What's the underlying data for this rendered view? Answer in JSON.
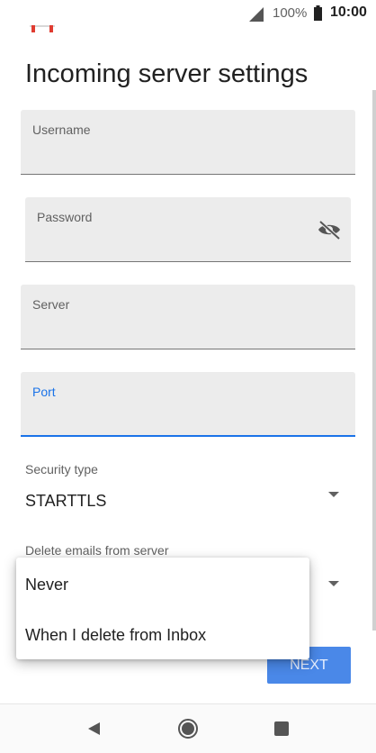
{
  "status_bar": {
    "battery_percent": "100%",
    "time": "10:00",
    "icons": [
      "gmail-icon",
      "signal-icon",
      "battery-icon"
    ]
  },
  "page": {
    "title": "Incoming server settings"
  },
  "fields": {
    "username": {
      "label": "Username",
      "value": ""
    },
    "password": {
      "label": "Password",
      "value": "",
      "toggle_icon": "visibility-off-icon"
    },
    "server": {
      "label": "Server",
      "value": ""
    },
    "port": {
      "label": "Port",
      "value": ""
    }
  },
  "security": {
    "label": "Security type",
    "value": "STARTTLS"
  },
  "delete_emails": {
    "label": "Delete emails from server"
  },
  "popup_menu": {
    "items": [
      "Never",
      "When I delete from Inbox"
    ]
  },
  "actions": {
    "next_label": "NEXT"
  },
  "colors": {
    "accent": "#1a73e8",
    "button": "#4a88e8",
    "field_background": "#ececec"
  },
  "nav_bar": {
    "icons": [
      "back-icon",
      "home-icon",
      "recents-icon"
    ]
  }
}
